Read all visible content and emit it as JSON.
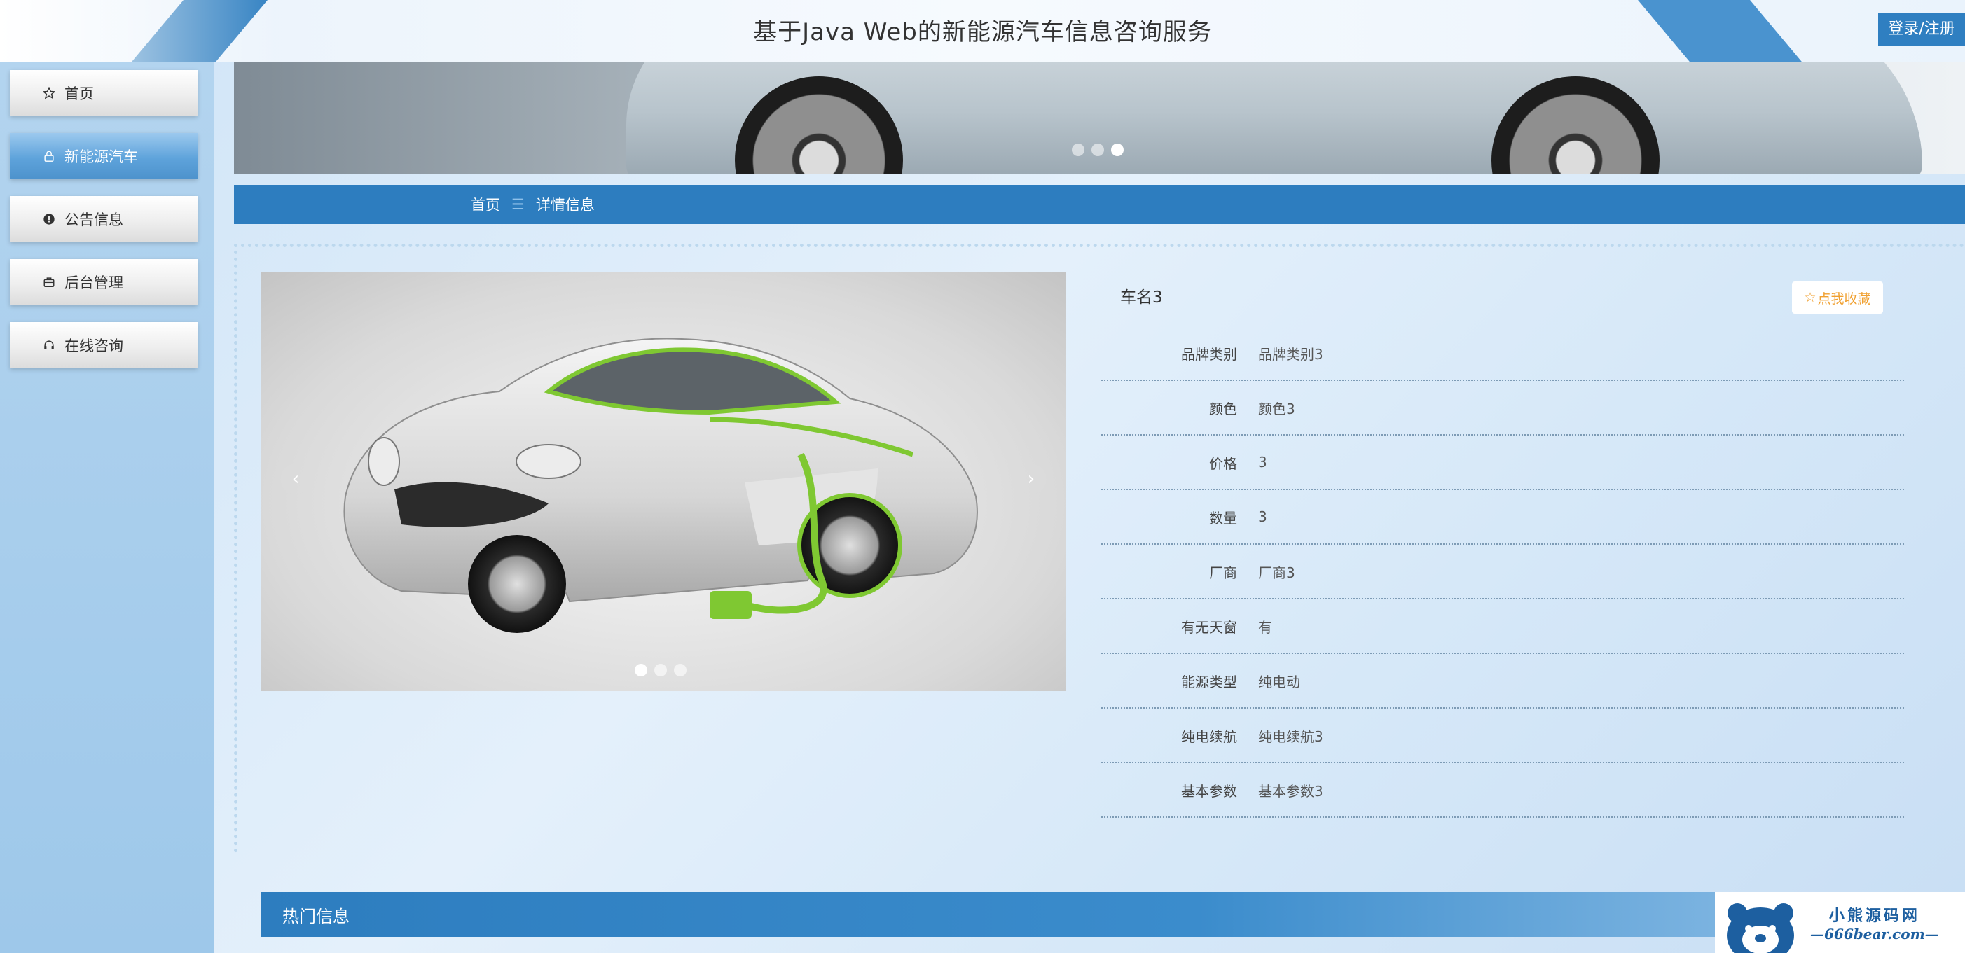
{
  "header": {
    "title": "基于Java Web的新能源汽车信息咨询服务",
    "login_label": "登录/注册"
  },
  "sidebar": {
    "items": [
      {
        "label": "首页",
        "icon": "star-icon",
        "active": false
      },
      {
        "label": "新能源汽车",
        "icon": "lock-icon",
        "active": true
      },
      {
        "label": "公告信息",
        "icon": "alert-icon",
        "active": false
      },
      {
        "label": "后台管理",
        "icon": "briefcase-icon",
        "active": false
      },
      {
        "label": "在线咨询",
        "icon": "headset-icon",
        "active": false
      }
    ]
  },
  "banner": {
    "slide_count": 3,
    "active_slide": 3
  },
  "breadcrumb": {
    "home": "首页",
    "separator": "☰",
    "current": "详情信息"
  },
  "gallery": {
    "prev_label": "‹",
    "next_label": "›",
    "slide_count": 3,
    "active_slide": 1,
    "image_lettering": "electric car"
  },
  "detail": {
    "title": "车名3",
    "favorite_label": "点我收藏",
    "rows": [
      {
        "label": "品牌类别",
        "value": "品牌类别3"
      },
      {
        "label": "颜色",
        "value": "颜色3"
      },
      {
        "label": "价格",
        "value": "3"
      },
      {
        "label": "数量",
        "value": "3"
      },
      {
        "label": "厂商",
        "value": "厂商3"
      },
      {
        "label": "有无天窗",
        "value": "有"
      },
      {
        "label": "能源类型",
        "value": "纯电动"
      },
      {
        "label": "纯电续航",
        "value": "纯电续航3"
      },
      {
        "label": "基本参数",
        "value": "基本参数3"
      }
    ]
  },
  "hot": {
    "title": "热门信息"
  },
  "watermark": {
    "cn": "小熊源码网",
    "url": "—666bear.com—"
  },
  "colors": {
    "primary": "#2d7dbf",
    "favorite": "#f0a030",
    "sidebar_bg": "#a9cdec"
  }
}
